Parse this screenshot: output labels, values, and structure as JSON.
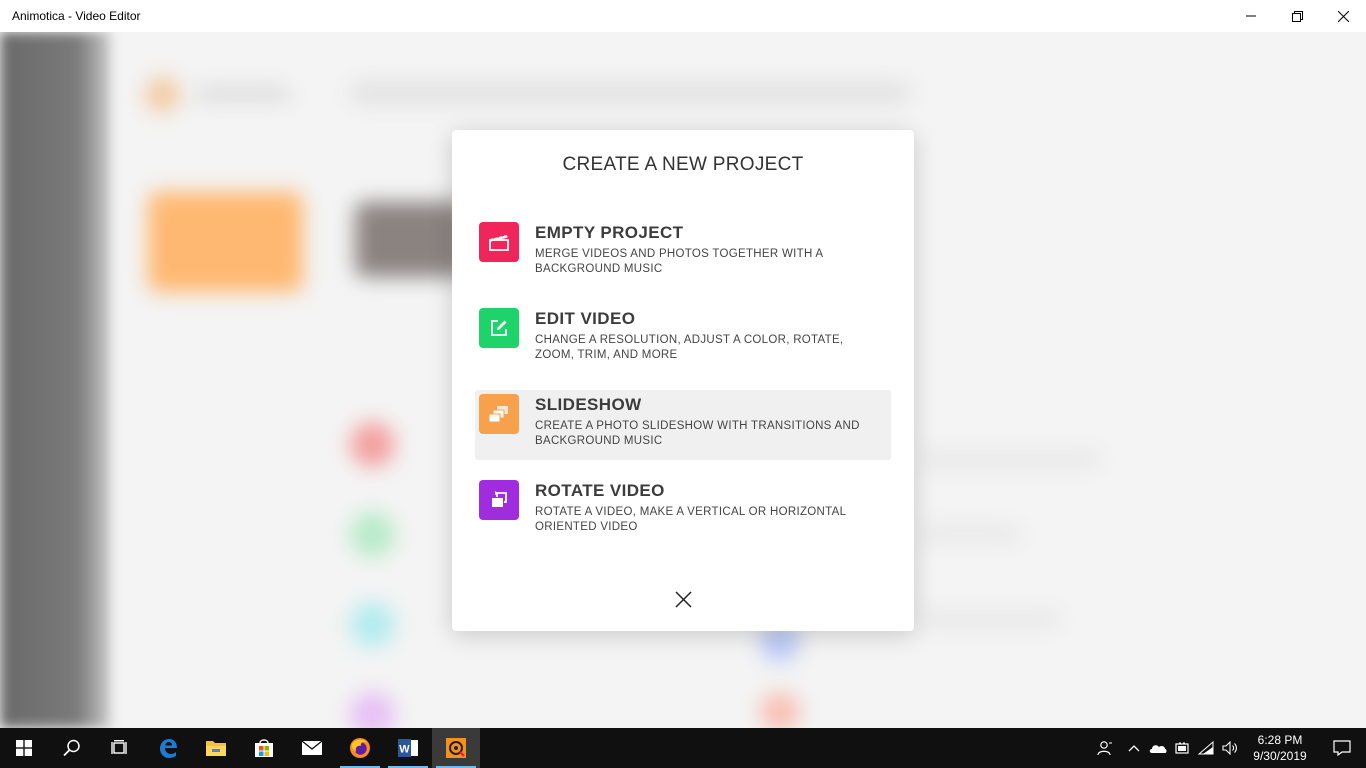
{
  "window": {
    "title": "Animotica - Video Editor",
    "controls": [
      "minimize-icon",
      "restore-icon",
      "close-icon"
    ]
  },
  "modal": {
    "title": "CREATE A NEW PROJECT",
    "options": [
      {
        "title": "EMPTY PROJECT",
        "description": "MERGE VIDEOS AND PHOTOS TOGETHER WITH A BACKGROUND MUSIC",
        "icon": "clapperboard-icon",
        "color": "#f0265a"
      },
      {
        "title": "EDIT VIDEO",
        "description": "CHANGE A RESOLUTION, ADJUST A COLOR, ROTATE, ZOOM, TRIM, AND MORE",
        "icon": "edit-icon",
        "color": "#1fd36b"
      },
      {
        "title": "SLIDESHOW",
        "description": "CREATE A PHOTO SLIDESHOW WITH TRANSITIONS AND BACKGROUND MUSIC",
        "icon": "slides-icon",
        "color": "#f7a14c"
      },
      {
        "title": "ROTATE VIDEO",
        "description": "ROTATE A VIDEO, MAKE A VERTICAL OR HORIZONTAL ORIENTED VIDEO",
        "icon": "rotate-icon",
        "color": "#a02ce0"
      }
    ],
    "close_icon": "close-icon"
  },
  "taskbar": {
    "apps": [
      "start-icon",
      "search-icon",
      "task-view-icon",
      "edge-icon",
      "file-explorer-icon",
      "store-icon",
      "mail-icon",
      "firefox-icon",
      "word-icon",
      "animotica-icon"
    ],
    "tray_icons": [
      "people-icon",
      "chevron-up-icon",
      "onedrive-icon",
      "battery-icon",
      "wifi-icon",
      "volume-icon"
    ],
    "time": "6:28 PM",
    "date": "9/30/2019",
    "notification_icon": "action-center-icon"
  }
}
